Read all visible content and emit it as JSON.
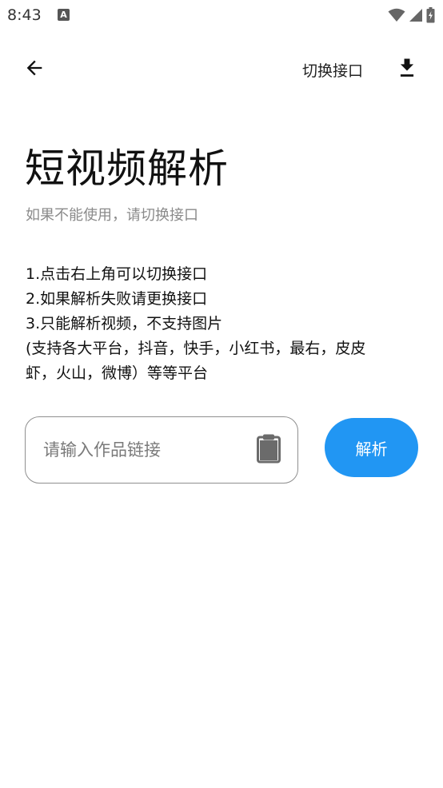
{
  "status_bar": {
    "time": "8:43",
    "notification_glyph": "A",
    "icons": [
      "wifi-icon",
      "cell-signal-icon",
      "battery-charging-icon"
    ]
  },
  "app_bar": {
    "back_icon": "arrow-left-icon",
    "switch_label": "切换接口",
    "download_icon": "download-icon"
  },
  "main": {
    "title": "短视频解析",
    "subtitle": "如果不能使用，请切换接口",
    "instructions": [
      "1.点击右上角可以切换接口",
      "2.如果解析失败请更换接口",
      "3.只能解析视频，不支持图片",
      "(支持各大平台，抖音，快手，小红书，最右，皮皮",
      "虾，火山，微博）等等平台"
    ],
    "input": {
      "placeholder": "请输入作品链接",
      "value": ""
    },
    "paste_icon": "clipboard-icon",
    "parse_label": "解析"
  },
  "colors": {
    "accent": "#2196f3",
    "subtitle": "#8a8a8a",
    "border": "#8f8f8f"
  }
}
